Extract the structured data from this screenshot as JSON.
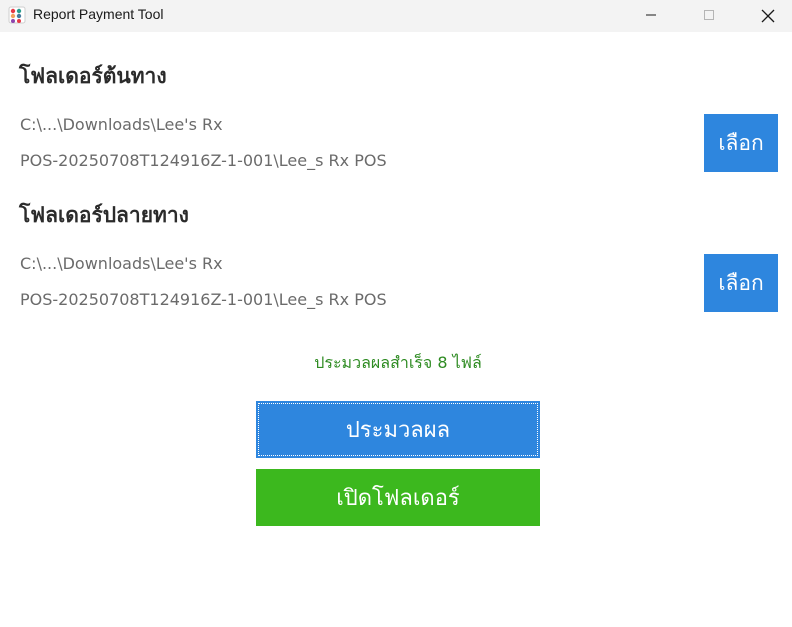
{
  "window": {
    "title": "Report Payment Tool"
  },
  "source": {
    "heading": "โฟลเดอร์ต้นทาง",
    "path_line1": "C:\\...\\Downloads\\Lee's Rx",
    "path_line2": "POS-20250708T124916Z-1-001\\Lee_s Rx POS",
    "browse_label": "เลือก"
  },
  "destination": {
    "heading": "โฟลเดอร์ปลายทาง",
    "path_line1": "C:\\...\\Downloads\\Lee's Rx",
    "path_line2": "POS-20250708T124916Z-1-001\\Lee_s Rx POS",
    "browse_label": "เลือก"
  },
  "status": {
    "message": "ประมวลผลสำเร็จ 8 ไฟล์"
  },
  "actions": {
    "process_label": "ประมวลผล",
    "open_folder_label": "เปิดโฟลเดอร์"
  },
  "colors": {
    "button_blue": "#2e86de",
    "button_green": "#3cb81e",
    "status_green": "#2e8b22",
    "titlebar_bg": "#f3f3f3"
  },
  "icons": [
    "app-icon",
    "minimize-icon",
    "maximize-icon",
    "close-icon"
  ]
}
